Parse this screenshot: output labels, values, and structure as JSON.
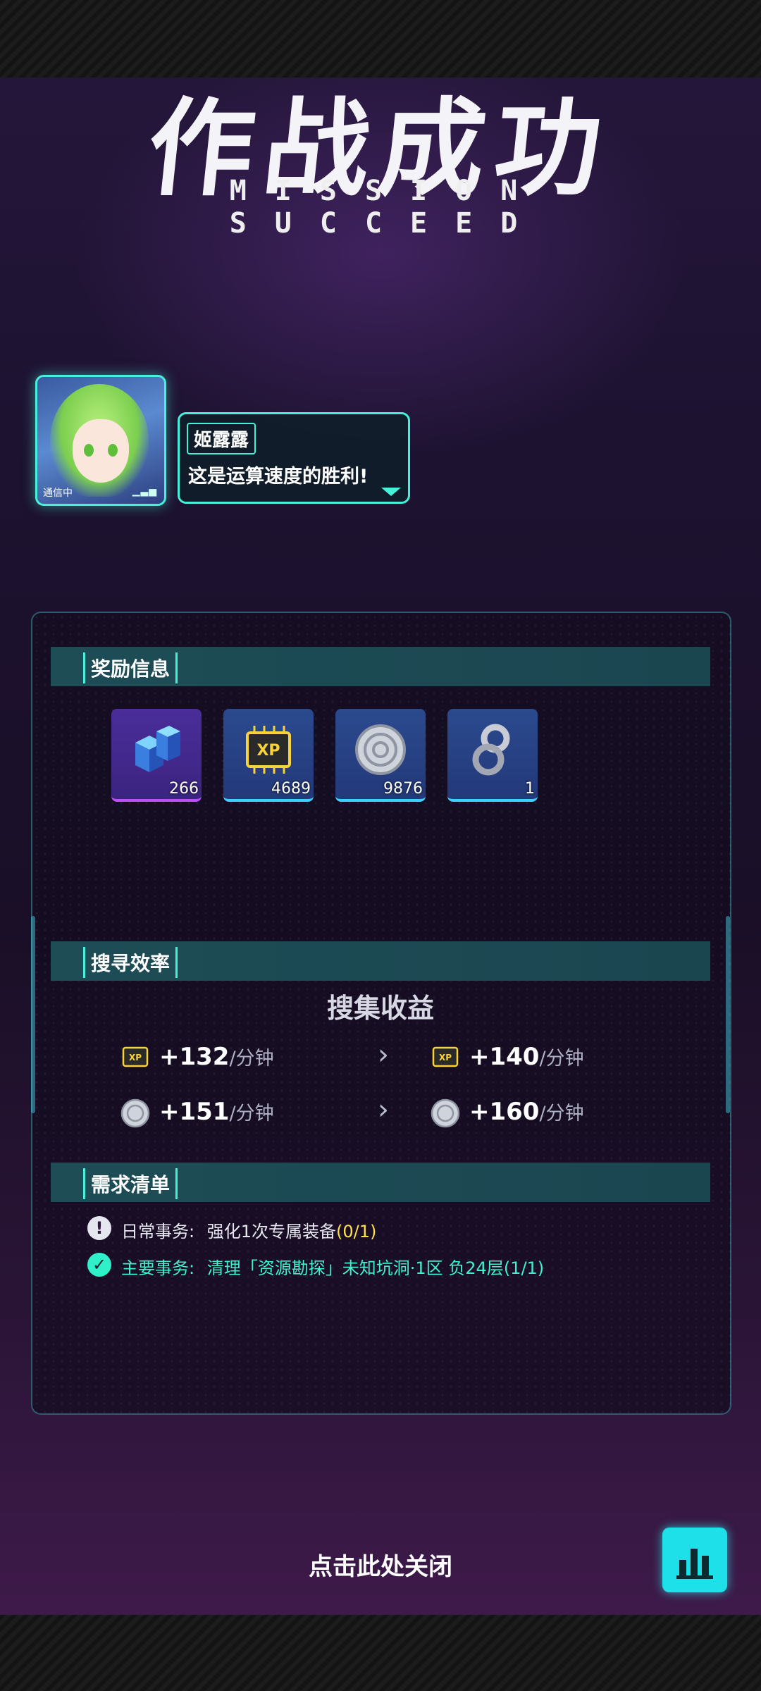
{
  "title": {
    "cn": "作战成功",
    "en": "MISSION SUCCEED"
  },
  "dialogue": {
    "status": "通信中",
    "speaker": "姬露露",
    "message": "这是运算速度的胜利!"
  },
  "rewards": {
    "section_label": "奖励信息",
    "items": [
      {
        "name": "cube-icon",
        "quantity": "266",
        "rarity_color": "#c04cff"
      },
      {
        "name": "xp-chip-icon",
        "quantity": "4689",
        "rarity_color": "#3ad0ff"
      },
      {
        "name": "coin-icon",
        "quantity": "9876",
        "rarity_color": "#3ad0ff"
      },
      {
        "name": "infinity-ring-icon",
        "quantity": "1",
        "rarity_color": "#3ad0ff"
      }
    ]
  },
  "efficiency": {
    "section_label": "搜寻效率",
    "title": "搜集收益",
    "rows": [
      {
        "icon": "xp-chip-icon",
        "from": "+132",
        "to": "+140",
        "unit": "/分钟"
      },
      {
        "icon": "coin-icon",
        "from": "+151",
        "to": "+160",
        "unit": "/分钟"
      }
    ]
  },
  "requirements": {
    "section_label": "需求清单",
    "tasks": [
      {
        "status_icon": "exclamation-icon",
        "type": "日常事务:",
        "desc": "强化1次专属装备",
        "progress": "(0/1)",
        "complete": false
      },
      {
        "status_icon": "check-icon",
        "type": "主要事务:",
        "desc": "清理「资源勘探」未知坑洞·1区 负24层",
        "progress": "(1/1)",
        "complete": true
      }
    ]
  },
  "close_label": "点击此处关闭",
  "colors": {
    "accent": "#47f0d8",
    "highlight": "#ffe14a",
    "panel_bg": "#140c20"
  }
}
